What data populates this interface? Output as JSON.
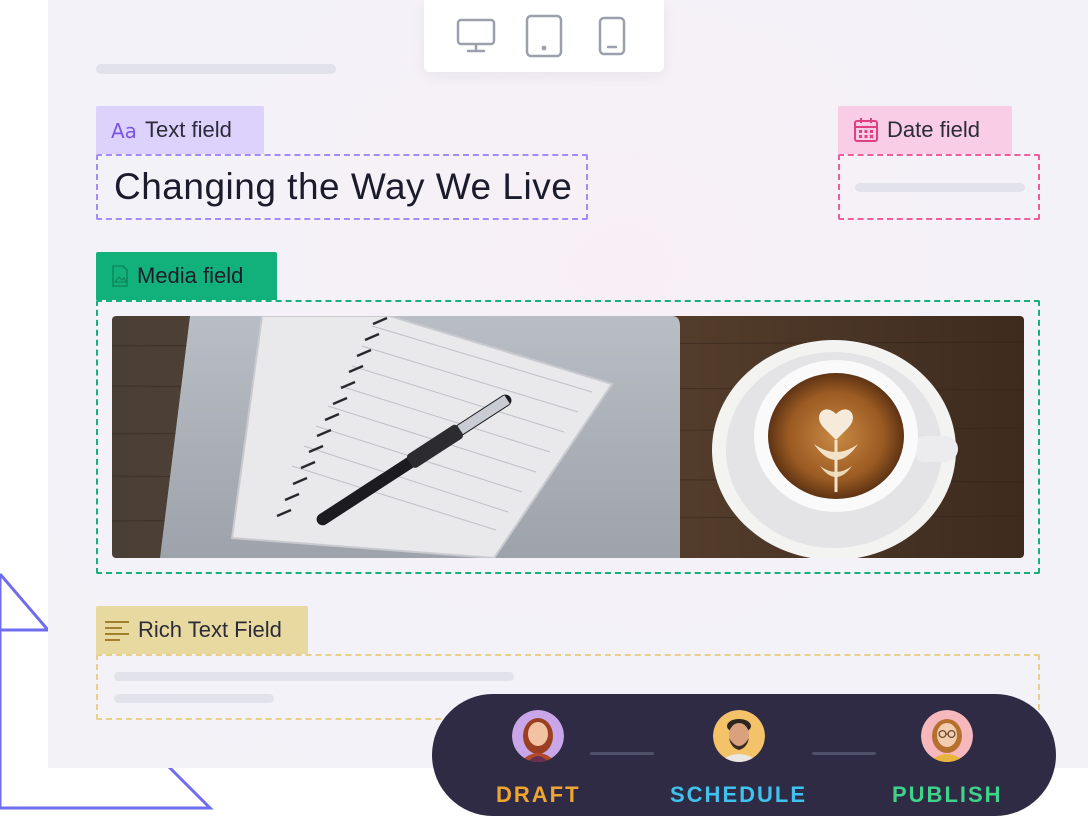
{
  "device_toggle": {
    "items": [
      {
        "icon": "desktop-icon"
      },
      {
        "icon": "tablet-icon"
      },
      {
        "icon": "mobile-icon"
      }
    ]
  },
  "fields": {
    "text": {
      "label": "Text field",
      "icon": "text-format-icon",
      "color": "#dcd2fb",
      "value": "Changing the Way We Live"
    },
    "date": {
      "label": "Date field",
      "icon": "calendar-icon",
      "color": "#f8cde5"
    },
    "media": {
      "label": "Media field",
      "icon": "image-file-icon",
      "color": "#12b07a"
    },
    "rich": {
      "label": "Rich Text Field",
      "icon": "text-lines-icon",
      "color": "#e8d9a0"
    }
  },
  "workflow": {
    "background": "#2f2b44",
    "stages": [
      {
        "label": "DRAFT",
        "color": "#f0a530",
        "avatar": "avatar-woman-red-hair"
      },
      {
        "label": "SCHEDULE",
        "color": "#3fc3ee",
        "avatar": "avatar-man-beard"
      },
      {
        "label": "PUBLISH",
        "color": "#3fd28a",
        "avatar": "avatar-woman-glasses"
      }
    ]
  }
}
